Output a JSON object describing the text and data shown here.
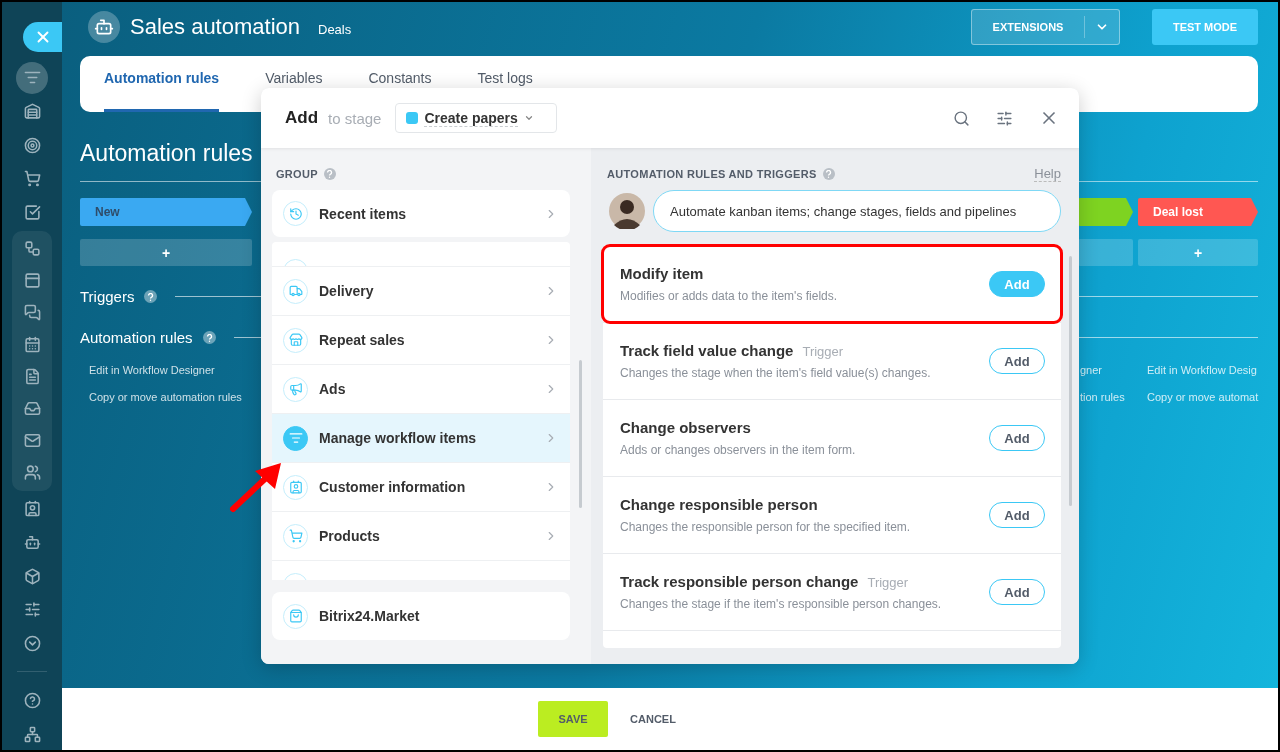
{
  "sidebar": {
    "items": [
      {
        "selected": false
      },
      {
        "selected": true
      },
      {
        "selected": false
      },
      {
        "selected": false
      },
      {
        "selected": false
      },
      {
        "selected": false
      },
      {
        "selected": false
      },
      {
        "selected": false
      },
      {
        "selected": false
      },
      {
        "selected": false
      },
      {
        "selected": false
      },
      {
        "selected": false
      },
      {
        "selected": false
      },
      {
        "selected": false
      },
      {
        "selected": false
      },
      {
        "selected": false
      },
      {
        "selected": false
      },
      {
        "selected": false
      },
      {
        "selected": false
      },
      {
        "selected": false
      },
      {
        "selected": false
      }
    ]
  },
  "header": {
    "title": "Sales automation",
    "subtitle": "Deals",
    "extensions": "EXTENSIONS",
    "test_mode": "TEST MODE"
  },
  "tabs": [
    {
      "label": "Automation rules",
      "selected": true
    },
    {
      "label": "Variables",
      "selected": false
    },
    {
      "label": "Constants",
      "selected": false
    },
    {
      "label": "Test logs",
      "selected": false
    }
  ],
  "heading": "Automation rules",
  "stages_left": [
    {
      "label": "New",
      "color": "#3aa9f2",
      "add": "+"
    }
  ],
  "stages_right": [
    {
      "color": "#7ed321"
    },
    {
      "label": "Deal lost",
      "color": "#ff5752",
      "add": "+"
    }
  ],
  "triggers": "Triggers",
  "automation_rules": "Automation rules",
  "links_left": [
    "Edit in Workflow Designer",
    "Copy or move automation rules"
  ],
  "links_right": [
    [
      "gner",
      "tion rules"
    ],
    [
      "Edit in Workflow Desig",
      "Copy or move automat"
    ]
  ],
  "modal": {
    "title": "Add",
    "stage_prefix": "to stage",
    "stage": "Create papers",
    "group_label": "GROUP",
    "recent": "Recent items",
    "groups": [
      {
        "label": "Delivery",
        "selected": false
      },
      {
        "label": "Repeat sales",
        "selected": false
      },
      {
        "label": "Ads",
        "selected": false
      },
      {
        "label": "Manage workflow items",
        "selected": true
      },
      {
        "label": "Customer information",
        "selected": false
      },
      {
        "label": "Products",
        "selected": false
      }
    ],
    "market": "Bitrix24.Market",
    "rules_label": "AUTOMATION RULES AND TRIGGERS",
    "help": "Help",
    "hint": "Automate kanban items; change stages, fields and pipelines",
    "rules": [
      {
        "title": "Modify item",
        "description": "Modifies or adds data to the item's fields.",
        "button": "Add",
        "highlighted": true
      },
      {
        "title": "Track field value change",
        "tag": "Trigger",
        "description": "Changes the stage when the item's field value(s) changes.",
        "button": "Add",
        "highlighted": false
      },
      {
        "title": "Change observers",
        "description": "Adds or changes observers in the item form.",
        "button": "Add",
        "highlighted": false
      },
      {
        "title": "Change responsible person",
        "description": "Changes the responsible person for the specified item.",
        "button": "Add",
        "highlighted": false
      },
      {
        "title": "Track responsible person change",
        "tag": "Trigger",
        "description": "Changes the stage if the item's responsible person changes.",
        "button": "Add",
        "highlighted": false
      }
    ]
  },
  "footer": {
    "save": "SAVE",
    "cancel": "CANCEL"
  }
}
